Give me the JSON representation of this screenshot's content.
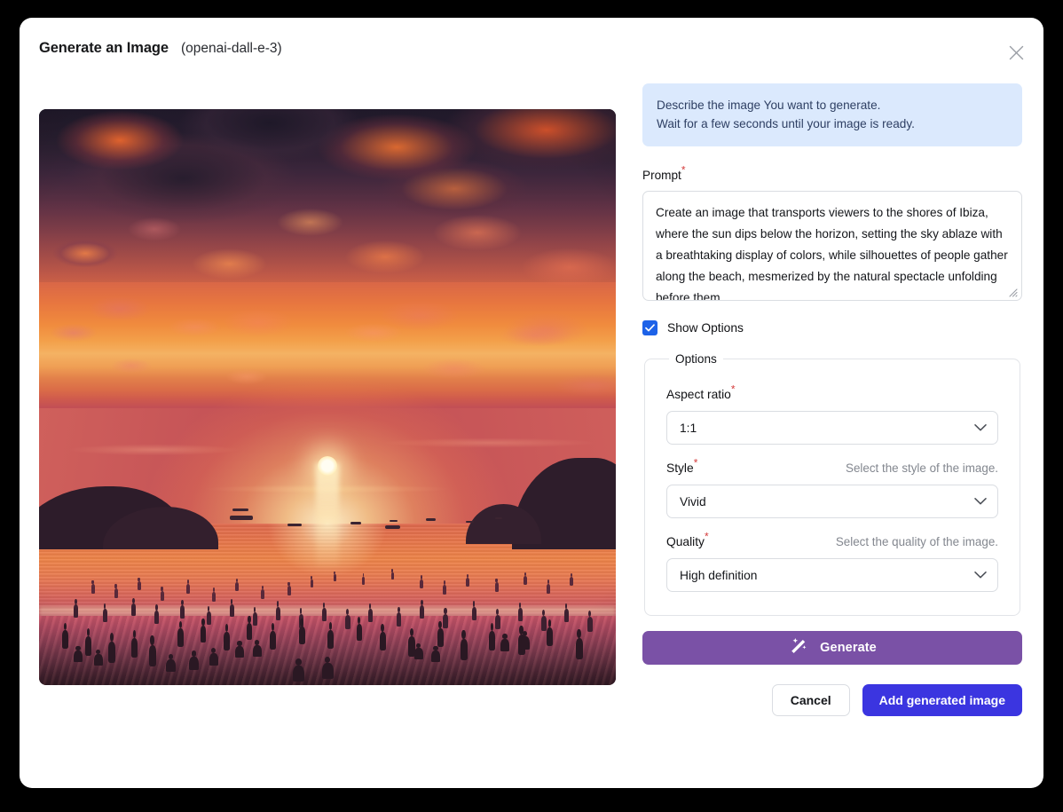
{
  "dialog": {
    "title": "Generate an Image",
    "model": "(openai-dall-e-3)",
    "close_icon": "close-icon"
  },
  "banner": {
    "line1": "Describe the image You want to generate.",
    "line2": "Wait for a few seconds until your image is ready."
  },
  "prompt": {
    "label": "Prompt",
    "required_marker": "*",
    "value": "Create an image that transports viewers to the shores of Ibiza, where the sun dips below the horizon, setting the sky ablaze with a breathtaking display of colors, while silhouettes of people gather along the beach, mesmerized by the natural spectacle unfolding before them"
  },
  "show_options": {
    "label": "Show Options",
    "checked": true
  },
  "options": {
    "legend": "Options",
    "aspect_ratio": {
      "label": "Aspect ratio",
      "required_marker": "*",
      "value": "1:1",
      "hint": ""
    },
    "style": {
      "label": "Style",
      "required_marker": "*",
      "value": "Vivid",
      "hint": "Select the style of the image."
    },
    "quality": {
      "label": "Quality",
      "required_marker": "*",
      "value": "High definition",
      "hint": "Select the quality of the image."
    }
  },
  "generate": {
    "label": "Generate",
    "icon": "magic-wand-icon",
    "color": "#7a51a6"
  },
  "footer": {
    "cancel_label": "Cancel",
    "add_label": "Add generated image",
    "add_color": "#3b35e0"
  },
  "preview": {
    "alt": "AI generated sunset over Ibiza beach with silhouetted crowd"
  },
  "colors": {
    "banner_bg": "#dbe9fd",
    "banner_text": "#2e3f63",
    "checkbox_blue": "#1d62e8",
    "required_red": "#d43b3b",
    "backdrop": "#000000"
  }
}
